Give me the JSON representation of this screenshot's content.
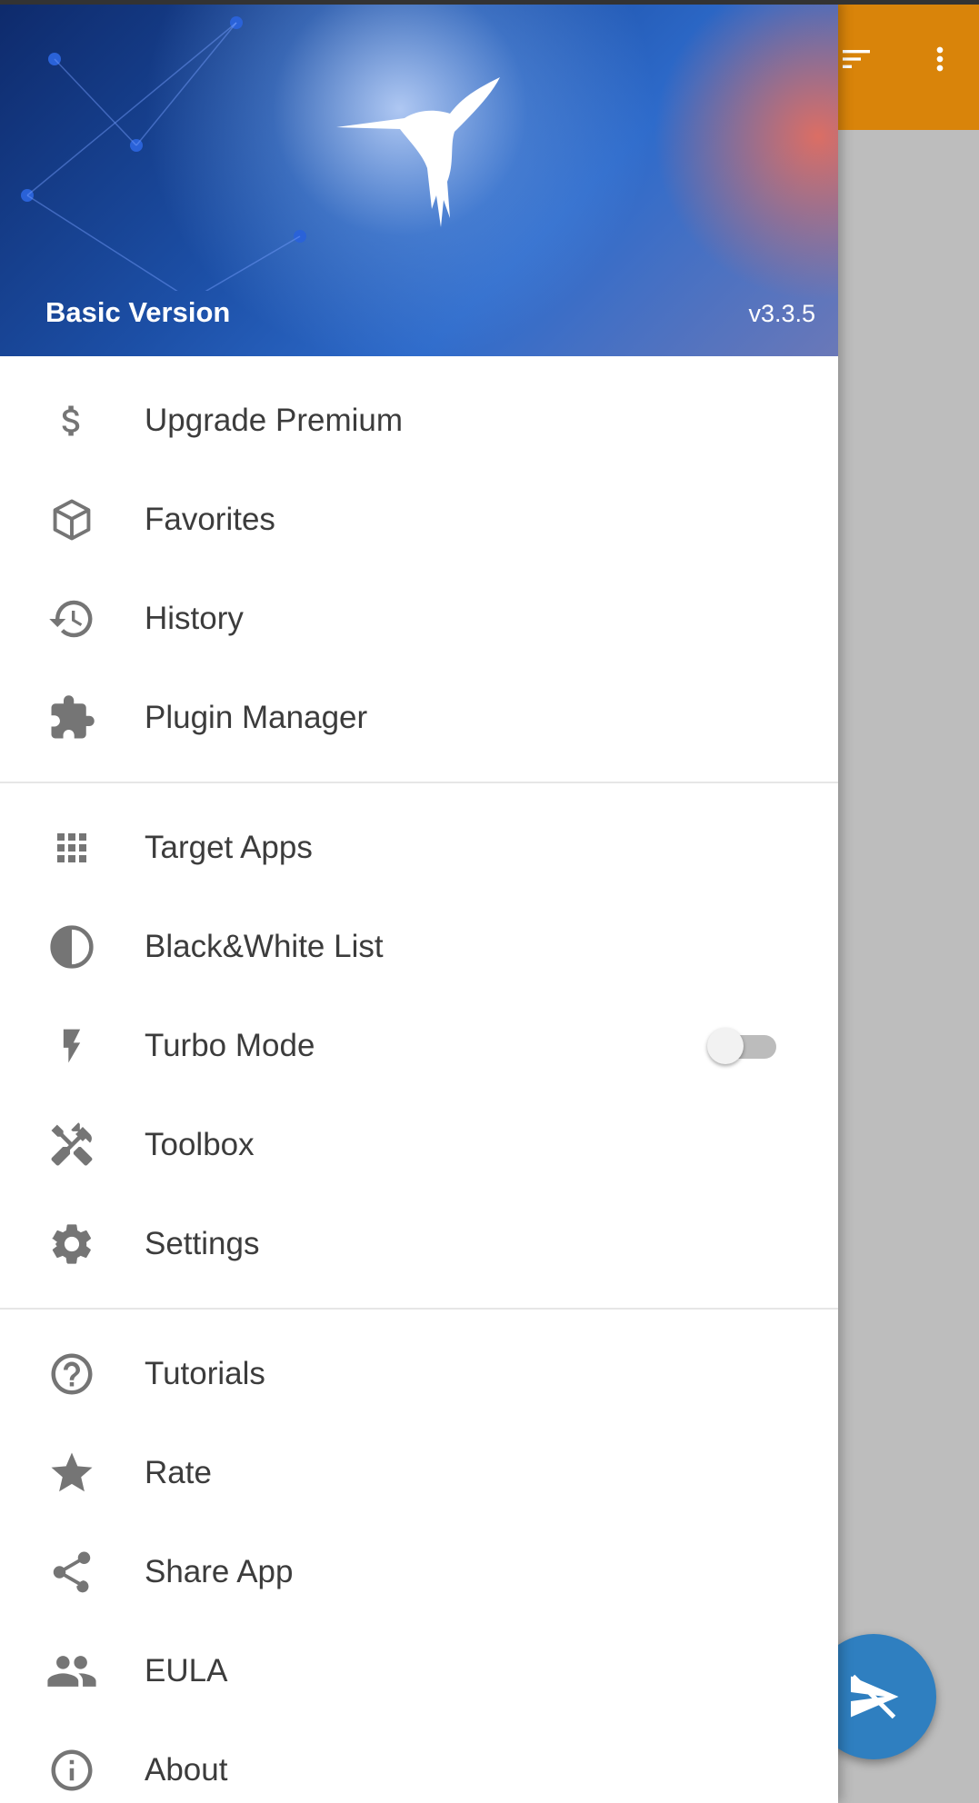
{
  "header": {
    "title": "Basic Version",
    "version": "v3.3.5"
  },
  "menu": {
    "section1": [
      {
        "label": "Upgrade Premium",
        "icon": "dollar-icon"
      },
      {
        "label": "Favorites",
        "icon": "cube-icon"
      },
      {
        "label": "History",
        "icon": "history-icon"
      },
      {
        "label": "Plugin Manager",
        "icon": "puzzle-icon"
      }
    ],
    "section2": [
      {
        "label": "Target Apps",
        "icon": "apps-grid-icon"
      },
      {
        "label": "Black&White List",
        "icon": "contrast-icon"
      },
      {
        "label": "Turbo Mode",
        "icon": "flash-icon",
        "toggle": false
      },
      {
        "label": "Toolbox",
        "icon": "tools-icon"
      },
      {
        "label": "Settings",
        "icon": "gear-icon"
      }
    ],
    "section3": [
      {
        "label": "Tutorials",
        "icon": "help-icon"
      },
      {
        "label": "Rate",
        "icon": "star-icon"
      },
      {
        "label": "Share App",
        "icon": "share-icon"
      },
      {
        "label": "EULA",
        "icon": "people-icon"
      },
      {
        "label": "About",
        "icon": "info-icon"
      }
    ]
  },
  "colors": {
    "accent": "#d9840a",
    "fab": "#2f7fc0",
    "icon": "#757575"
  }
}
